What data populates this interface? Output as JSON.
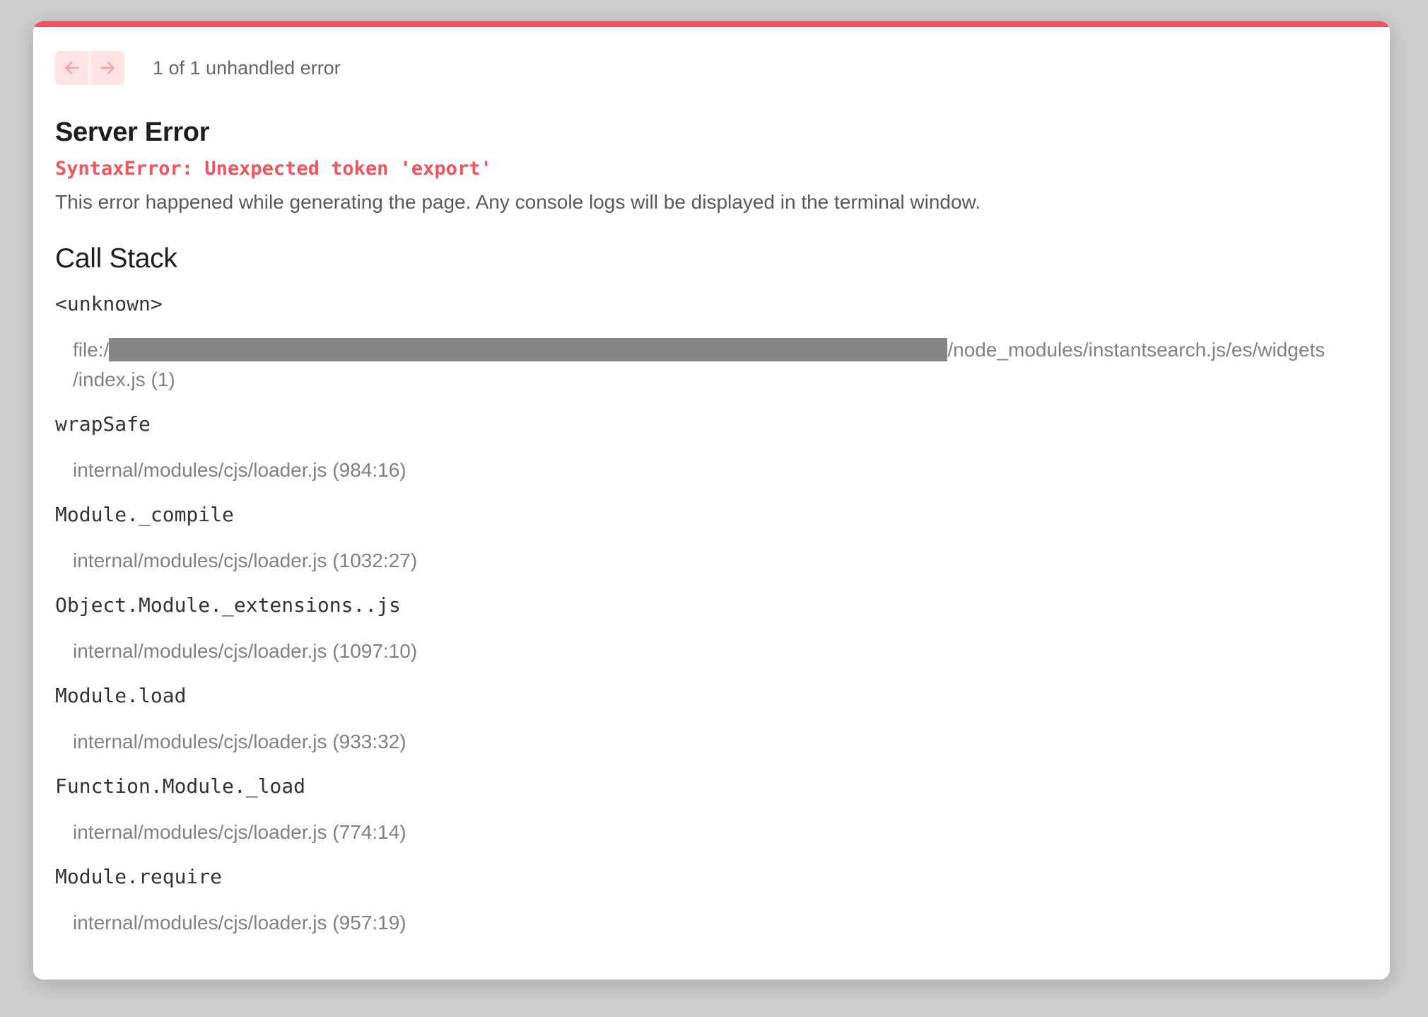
{
  "header": {
    "error_count": "1 of 1 unhandled error",
    "prev_icon": "arrow-left-icon",
    "next_icon": "arrow-right-icon"
  },
  "error": {
    "title": "Server Error",
    "message": "SyntaxError: Unexpected token 'export'",
    "description": "This error happened while generating the page. Any console logs will be displayed in the terminal window."
  },
  "call_stack": {
    "title": "Call Stack",
    "frames": [
      {
        "fn": "<unknown>",
        "loc_prefix": "file:/",
        "loc_suffix": "/node_modules/instantsearch.js/es/widgets",
        "loc_line2": "/index.js (1)"
      },
      {
        "fn": "wrapSafe",
        "loc": "internal/modules/cjs/loader.js (984:16)"
      },
      {
        "fn": "Module._compile",
        "loc": "internal/modules/cjs/loader.js (1032:27)"
      },
      {
        "fn": "Object.Module._extensions..js",
        "loc": "internal/modules/cjs/loader.js (1097:10)"
      },
      {
        "fn": "Module.load",
        "loc": "internal/modules/cjs/loader.js (933:32)"
      },
      {
        "fn": "Function.Module._load",
        "loc": "internal/modules/cjs/loader.js (774:14)"
      },
      {
        "fn": "Module.require",
        "loc": "internal/modules/cjs/loader.js (957:19)"
      }
    ]
  },
  "colors": {
    "accent": "#f0545c",
    "nav_button_bg": "#fde3e4",
    "nav_arrow": "#f6a3a7"
  }
}
